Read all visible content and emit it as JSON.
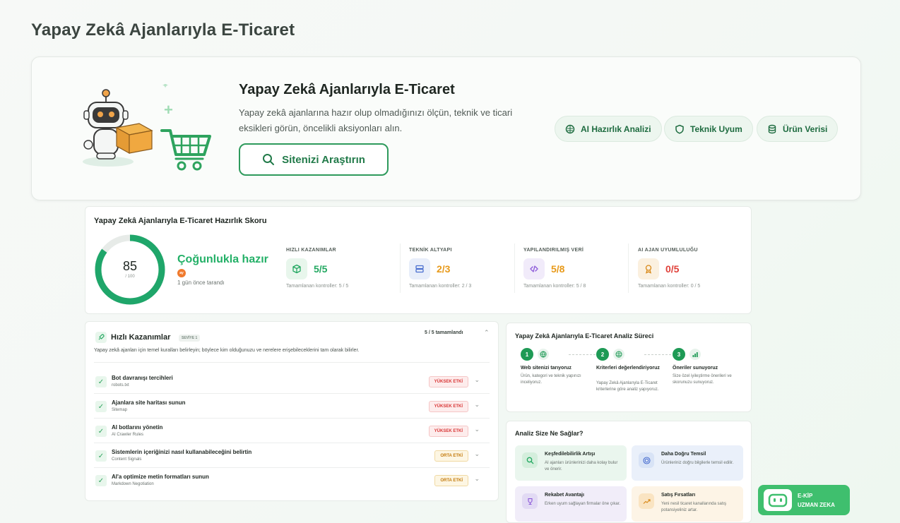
{
  "page": {
    "title": "Yapay Zekâ Ajanlarıyla E-Ticaret"
  },
  "hero": {
    "title": "Yapay Zekâ Ajanlarıyla E-Ticaret",
    "description": "Yapay zekâ ajanlarına hazır olup olmadığınızı ölçün, teknik ve ticari eksikleri görün, öncelikli aksiyonları alın.",
    "search_button": "Sitenizi Araştırın",
    "pills": [
      "AI Hazırlık Analizi",
      "Teknik Uyum",
      "Ürün Verisi"
    ]
  },
  "score": {
    "title": "Yapay Zekâ Ajanlarıyla E-Ticaret Hazırlık Skoru",
    "value": "85",
    "max": "/ 100",
    "fraction": 0.85,
    "status": "Çoğunlukla hazır",
    "badge": "ay",
    "scanned": "1 gün önce tarandı",
    "metrics": [
      {
        "label": "HIZLI KAZANIMLAR",
        "value": "5/5",
        "sub": "Tamamlanan kontroller: 5 / 5",
        "color": "#23a861"
      },
      {
        "label": "TEKNİK ALTYAPI",
        "value": "2/3",
        "sub": "Tamamlanan kontroller: 2 / 3",
        "color": "#e89a1a"
      },
      {
        "label": "YAPILANDIRILMIŞ VERİ",
        "value": "5/8",
        "sub": "Tamamlanan kontroller: 5 / 8",
        "color": "#e89a1a"
      },
      {
        "label": "AI AJAN UYUMLULUĞU",
        "value": "0/5",
        "sub": "Tamamlanan kontroller: 0 / 5",
        "color": "#e0413a"
      }
    ]
  },
  "quick": {
    "title": "Hızlı Kazanımlar",
    "level": "SEVİYE 1",
    "done": "5 / 5 tamamlandı",
    "description": "Yapay zekâ ajanları için temel kuralları belirleyin; böylece kim olduğunuzu ve nerelere erişebileceklerini tam olarak bilirler.",
    "items": [
      {
        "title": "Bot davranışı tercihleri",
        "sub": "robots.txt",
        "tag": "YÜKSEK ETKİ",
        "level": "high"
      },
      {
        "title": "Ajanlara site haritası sunun",
        "sub": "Sitemap",
        "tag": "YÜKSEK ETKİ",
        "level": "high"
      },
      {
        "title": "AI botlarını yönetin",
        "sub": "AI Crawler Rules",
        "tag": "YÜKSEK ETKİ",
        "level": "high"
      },
      {
        "title": "Sistemlerin içeriğinizi nasıl kullanabileceğini belirtin",
        "sub": "Content Signals",
        "tag": "ORTA ETKİ",
        "level": "mid"
      },
      {
        "title": "AI'a optimize metin formatları sunun",
        "sub": "Markdown Negotiation",
        "tag": "ORTA ETKİ",
        "level": "mid"
      }
    ]
  },
  "process": {
    "title": "Yapay Zekâ Ajanlarıyla E-Ticaret Analiz Süreci",
    "steps": [
      {
        "num": "1",
        "title": "Web sitenizi tarıyoruz",
        "desc": "Ürün, kategori ve teknik yapınızı inceliyoruz."
      },
      {
        "num": "2",
        "title": "Kriterleri değerlendiriyoruz",
        "desc": "Yapay Zekâ Ajanlarıyla E-Ticaret kriterlerine göre analiz yapıyoruz."
      },
      {
        "num": "3",
        "title": "Öneriler sunuyoruz",
        "desc": "Size özel iyileştirme önerileri ve skorunuzu sunuyoruz."
      }
    ]
  },
  "benefits": {
    "title": "Analiz Size Ne Sağlar?",
    "cards": [
      {
        "title": "Keşfedilebilirlik Artışı",
        "desc": "AI ajanları ürünlerinizi daha kolay bulur ve önerir.",
        "icon": "search-icon",
        "bg": "#eaf6ee"
      },
      {
        "title": "Daha Doğru Temsil",
        "desc": "Ürünleriniz doğru bilgilerle temsil edilir.",
        "icon": "target-icon",
        "bg": "#eaf0fa"
      },
      {
        "title": "Rekabet Avantajı",
        "desc": "Erken uyum sağlayan firmalar öne çıkar.",
        "icon": "trophy-icon",
        "bg": "#f1edf9"
      },
      {
        "title": "Satış Fırsatları",
        "desc": "Yeni nesil ticaret kanallarında satış potansiyeliniz artar.",
        "icon": "trend-up-icon",
        "bg": "#fdf4e6"
      }
    ]
  },
  "chat": {
    "line1": "E-KİP",
    "line2": "UZMAN ZEKA"
  }
}
